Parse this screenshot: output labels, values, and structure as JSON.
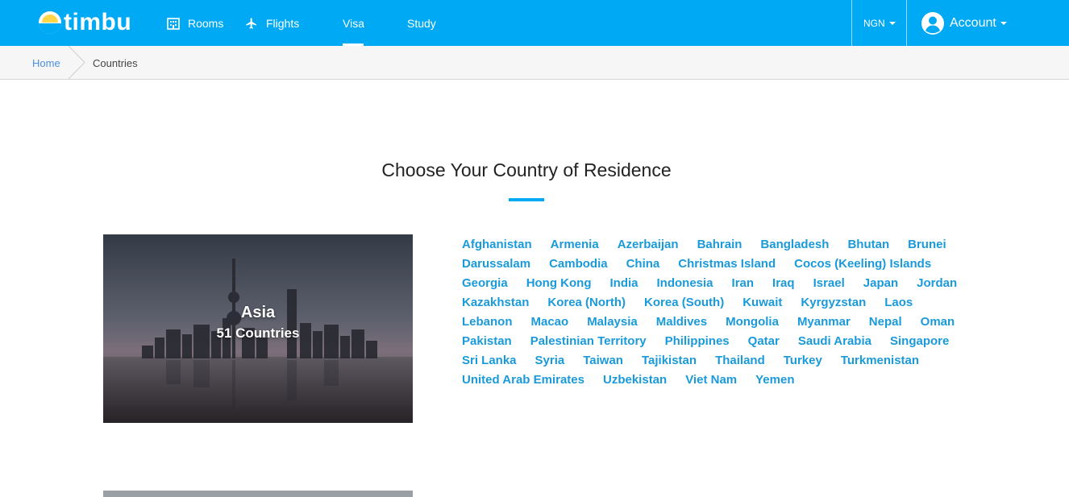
{
  "brand": {
    "name": "timbu"
  },
  "nav": {
    "items": [
      {
        "label": "Rooms",
        "icon": "building-icon"
      },
      {
        "label": "Flights",
        "icon": "airplane-icon"
      },
      {
        "label": "Visa"
      },
      {
        "label": "Study"
      }
    ],
    "active": "Visa",
    "currency": "NGN",
    "account_label": "Account"
  },
  "breadcrumb": {
    "home": "Home",
    "current": "Countries"
  },
  "page": {
    "title": "Choose Your Country of Residence"
  },
  "region": {
    "name": "Asia",
    "count_label": "51 Countries",
    "countries": [
      "Afghanistan",
      "Armenia",
      "Azerbaijan",
      "Bahrain",
      "Bangladesh",
      "Bhutan",
      "Brunei",
      "Darussalam",
      "Cambodia",
      "China",
      "Christmas Island",
      "Cocos (Keeling) Islands",
      "Georgia",
      "Hong Kong",
      "India",
      "Indonesia",
      "Iran",
      "Iraq",
      "Israel",
      "Japan",
      "Jordan",
      "Kazakhstan",
      "Korea (North)",
      "Korea (South)",
      "Kuwait",
      "Kyrgyzstan",
      "Laos",
      "Lebanon",
      "Macao",
      "Malaysia",
      "Maldives",
      "Mongolia",
      "Myanmar",
      "Nepal",
      "Oman",
      "Pakistan",
      "Palestinian Territory",
      "Philippines",
      "Qatar",
      "Saudi Arabia",
      "Singapore",
      "Sri Lanka",
      "Syria",
      "Taiwan",
      "Tajikistan",
      "Thailand",
      "Turkey",
      "Turkmenistan",
      "United Arab Emirates",
      "Uzbekistan",
      "Viet Nam",
      "Yemen"
    ]
  },
  "colors": {
    "primary": "#00a9f4",
    "link": "#1a9ad9"
  }
}
